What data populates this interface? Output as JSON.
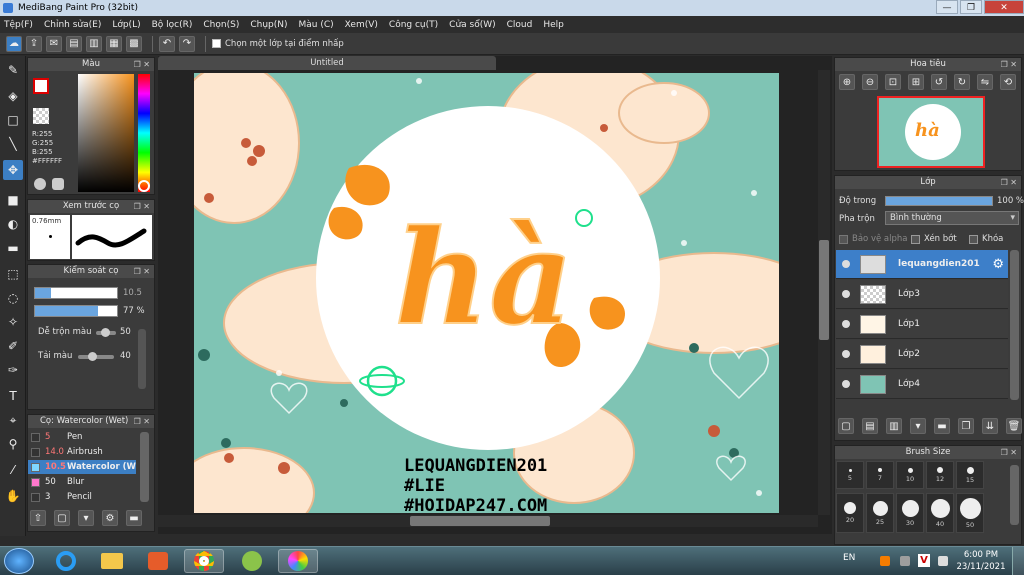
{
  "app": {
    "title": "MediBang Paint Pro (32bit)"
  },
  "menu": [
    "Tệp(F)",
    "Chỉnh sửa(E)",
    "Lớp(L)",
    "Bộ lọc(R)",
    "Chọn(S)",
    "Chụp(N)",
    "Màu (C)",
    "Xem(V)",
    "Công cụ(T)",
    "Cửa sổ(W)",
    "Cloud",
    "Help"
  ],
  "toolbar": {
    "select_layer_label": "Chọn một lớp tại điểm nhấp"
  },
  "color_panel": {
    "title": "Màu",
    "r": "R:255",
    "g": "G:255",
    "b": "B:255",
    "hex": "#FFFFFF"
  },
  "brush_preview": {
    "title": "Xem trước cọ",
    "size": "0.76mm"
  },
  "brush_control": {
    "title": "Kiểm soát cọ",
    "size_value": "10.5",
    "opacity_value": "77 %",
    "blend_label": "Dễ trộn màu",
    "blend_value": "50",
    "reload_label": "Tải màu",
    "reload_value": "40"
  },
  "brush_list": {
    "title": "Cọ: Watercolor (Wet)",
    "items": [
      {
        "size": "5",
        "name": "Pen",
        "color": "#333333"
      },
      {
        "size": "14.0",
        "name": "Airbrush",
        "color": "#333333"
      },
      {
        "size": "10.5",
        "name": "Watercolor (W",
        "color": "#7fd7ff"
      },
      {
        "size": "50",
        "name": "Blur",
        "color": "#ff77cc"
      },
      {
        "size": "3",
        "name": "Pencil",
        "color": "#333333"
      }
    ]
  },
  "document": {
    "tab": "Untitled"
  },
  "artwork": {
    "line1": "LEQUANGDIEN201",
    "line2": "#LIE",
    "line3": "#HOIDAP247.COM",
    "title": "hà"
  },
  "navigator": {
    "title": "Hoa tiêu"
  },
  "layer_panel": {
    "title": "Lớp",
    "opacity_label": "Độ trong",
    "opacity_value": "100 %",
    "blend_label": "Pha trộn",
    "blend_value": "Bình thường",
    "protect_alpha": "Bảo vệ alpha",
    "clipping": "Xén bớt",
    "lock": "Khóa",
    "layers": [
      {
        "name": "lequangdien201",
        "selected": true
      },
      {
        "name": "Lớp3",
        "selected": false
      },
      {
        "name": "Lớp1",
        "selected": false
      },
      {
        "name": "Lớp2",
        "selected": false
      },
      {
        "name": "Lớp4",
        "selected": false
      }
    ]
  },
  "brush_size": {
    "title": "Brush Size",
    "row1": [
      "5",
      "7",
      "10",
      "12",
      "15"
    ],
    "row2": [
      "20",
      "25",
      "30",
      "40",
      "50"
    ]
  },
  "taskbar": {
    "lang": "EN",
    "time": "6:00 PM",
    "date": "23/11/2021"
  },
  "colors": {
    "accent": "#3c7fc4",
    "art_bg": "#7fc4b4",
    "orange": "#f7931e"
  }
}
